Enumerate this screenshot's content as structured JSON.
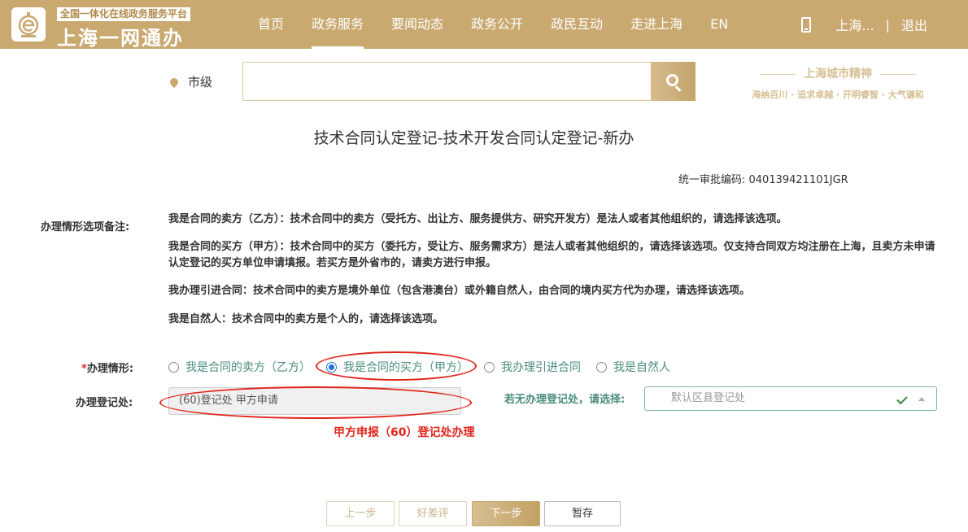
{
  "header": {
    "platform_subtitle": "全国一体化在线政务服务平台",
    "brand_title": "上海一网通办",
    "nav": [
      "首页",
      "政务服务",
      "要闻动态",
      "政务公开",
      "政民互动",
      "走进上海",
      "EN"
    ],
    "active_nav": "政务服务",
    "user_name": "上海...",
    "separator": "|",
    "logout": "退出"
  },
  "search": {
    "location": "市级",
    "query": ""
  },
  "spirit": {
    "title": "上海城市精神",
    "motto": "海纳百川 · 追求卓越 · 开明睿智 · 大气谦和"
  },
  "page": {
    "title": "技术合同认定登记-技术开发合同认定登记-新办",
    "code_label": "统一审批编码: 040139421101JGR"
  },
  "notes": {
    "label": "办理情形选项备注:",
    "items": [
      "我是合同的卖方（乙方）：技术合同中的卖方（受托方、出让方、服务提供方、研究开发方）是法人或者其他组织的，请选择该选项。",
      "我是合同的买方（甲方）：技术合同中的买方（委托方，受让方、服务需求方）是法人或者其他组织的，请选择该选项。仅支持合同双方均注册在上海，且卖方未申请认定登记的买方单位申请填报。若买方是外省市的，请卖方进行申报。",
      "我办理引进合同：技术合同中的卖方是境外单位（包含港澳台）或外籍自然人，由合同的境内买方代为办理，请选择该选项。",
      "我是自然人：技术合同中的卖方是个人的，请选择该选项。"
    ]
  },
  "form": {
    "situation_required_mark": "*",
    "situation_label": "办理情形:",
    "options": [
      "我是合同的卖方（乙方）",
      "我是合同的买方（甲方）",
      "我办理引进合同",
      "我是自然人"
    ],
    "selected_option": 1,
    "office_label": "办理登记处:",
    "office_value": "(60)登记处 甲方申请",
    "fallback_hint": "若无办理登记处，请选择:",
    "fallback_select_value": "默认区县登记处",
    "annotation": "甲方申报（60）登记处办理"
  },
  "buttons": {
    "prev": "上一步",
    "review": "好差评",
    "next": "下一步",
    "save": "暂存"
  },
  "colors": {
    "brand_gold": "#c9a970",
    "annotation_red": "#e0251b",
    "teal_text": "#4a8d7e",
    "radio_blue": "#1f73d8"
  }
}
